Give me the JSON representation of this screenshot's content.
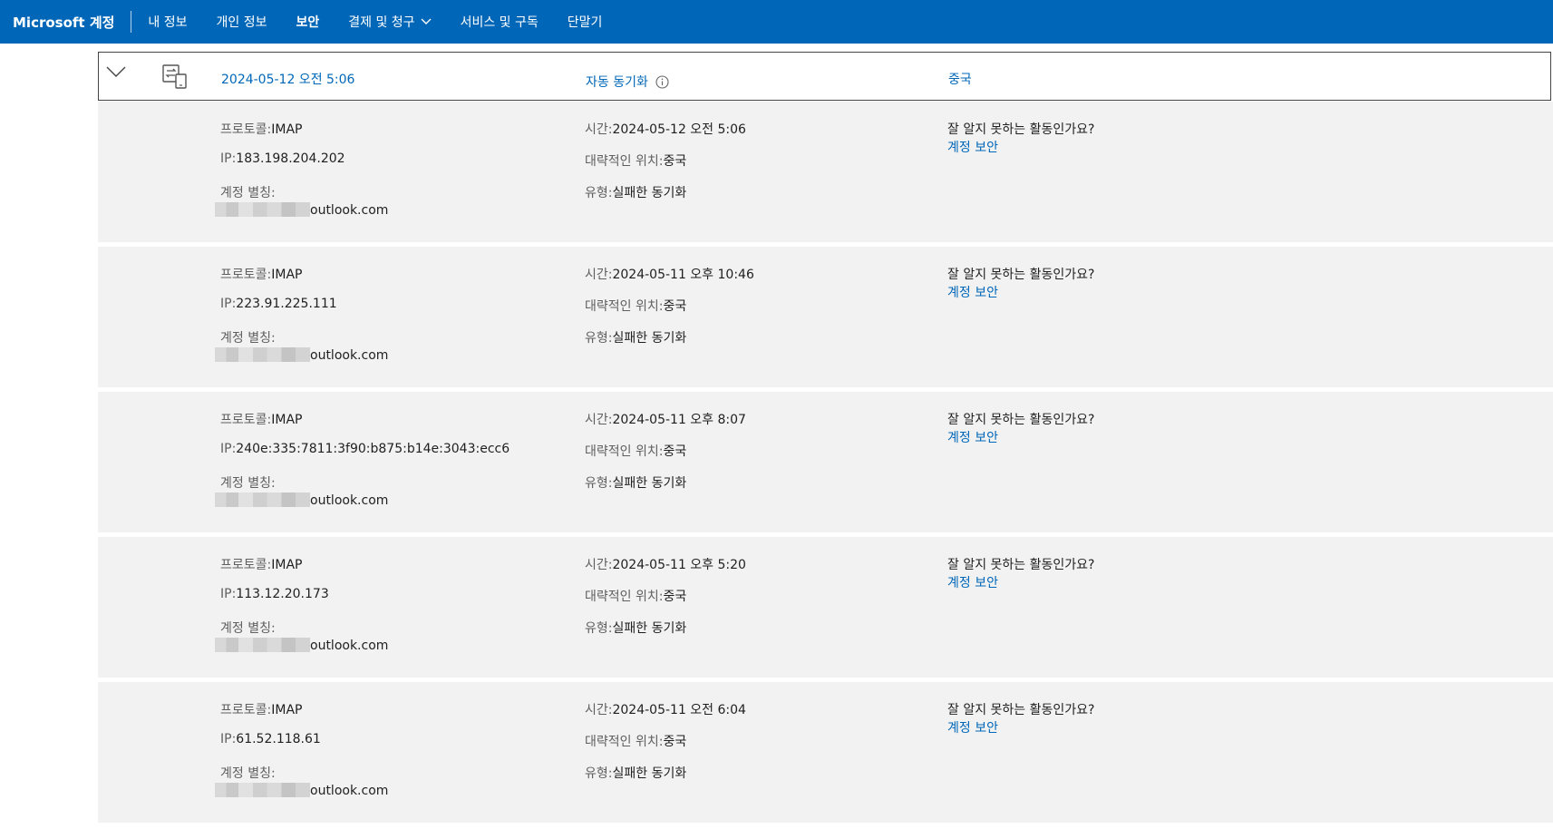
{
  "header": {
    "brand": "Microsoft 계정",
    "nav": [
      {
        "label": "내 정보",
        "active": false
      },
      {
        "label": "개인 정보",
        "active": false
      },
      {
        "label": "보안",
        "active": true
      },
      {
        "label": "결제 및 청구",
        "active": false,
        "dropdown": true
      },
      {
        "label": "서비스 및 구독",
        "active": false
      },
      {
        "label": "단말기",
        "active": false
      }
    ],
    "bg_color": "#0067b8"
  },
  "summary": {
    "date": "2024-05-12 오전 5:06",
    "type": "자동 동기화",
    "location": "중국",
    "icons": [
      "chevron-down-icon",
      "sync-devices-icon",
      "info-icon"
    ]
  },
  "labels": {
    "protocol": "프로토콜:",
    "ip": "IP:",
    "alias": "계정 별칭:",
    "time": "시간:",
    "location": "대략적인 위치:",
    "type": "유형:",
    "question": "잘 알지 못하는 활동인가요?",
    "secure_link": "계정 보안"
  },
  "activities": [
    {
      "protocol": "IMAP",
      "ip": "183.198.204.202",
      "alias_suffix": "outlook.com",
      "time": "2024-05-12 오전 5:06",
      "location": "중국",
      "type": "실패한 동기화"
    },
    {
      "protocol": "IMAP",
      "ip": "223.91.225.111",
      "alias_suffix": "outlook.com",
      "time": "2024-05-11 오후 10:46",
      "location": "중국",
      "type": "실패한 동기화"
    },
    {
      "protocol": "IMAP",
      "ip": "240e:335:7811:3f90:b875:b14e:3043:ecc6",
      "alias_suffix": "outlook.com",
      "time": "2024-05-11 오후 8:07",
      "location": "중국",
      "type": "실패한 동기화"
    },
    {
      "protocol": "IMAP",
      "ip": "113.12.20.173",
      "alias_suffix": "outlook.com",
      "time": "2024-05-11 오후 5:20",
      "location": "중국",
      "type": "실패한 동기화"
    },
    {
      "protocol": "IMAP",
      "ip": "61.52.118.61",
      "alias_suffix": "outlook.com",
      "time": "2024-05-11 오전 6:04",
      "location": "중국",
      "type": "실패한 동기화"
    }
  ]
}
